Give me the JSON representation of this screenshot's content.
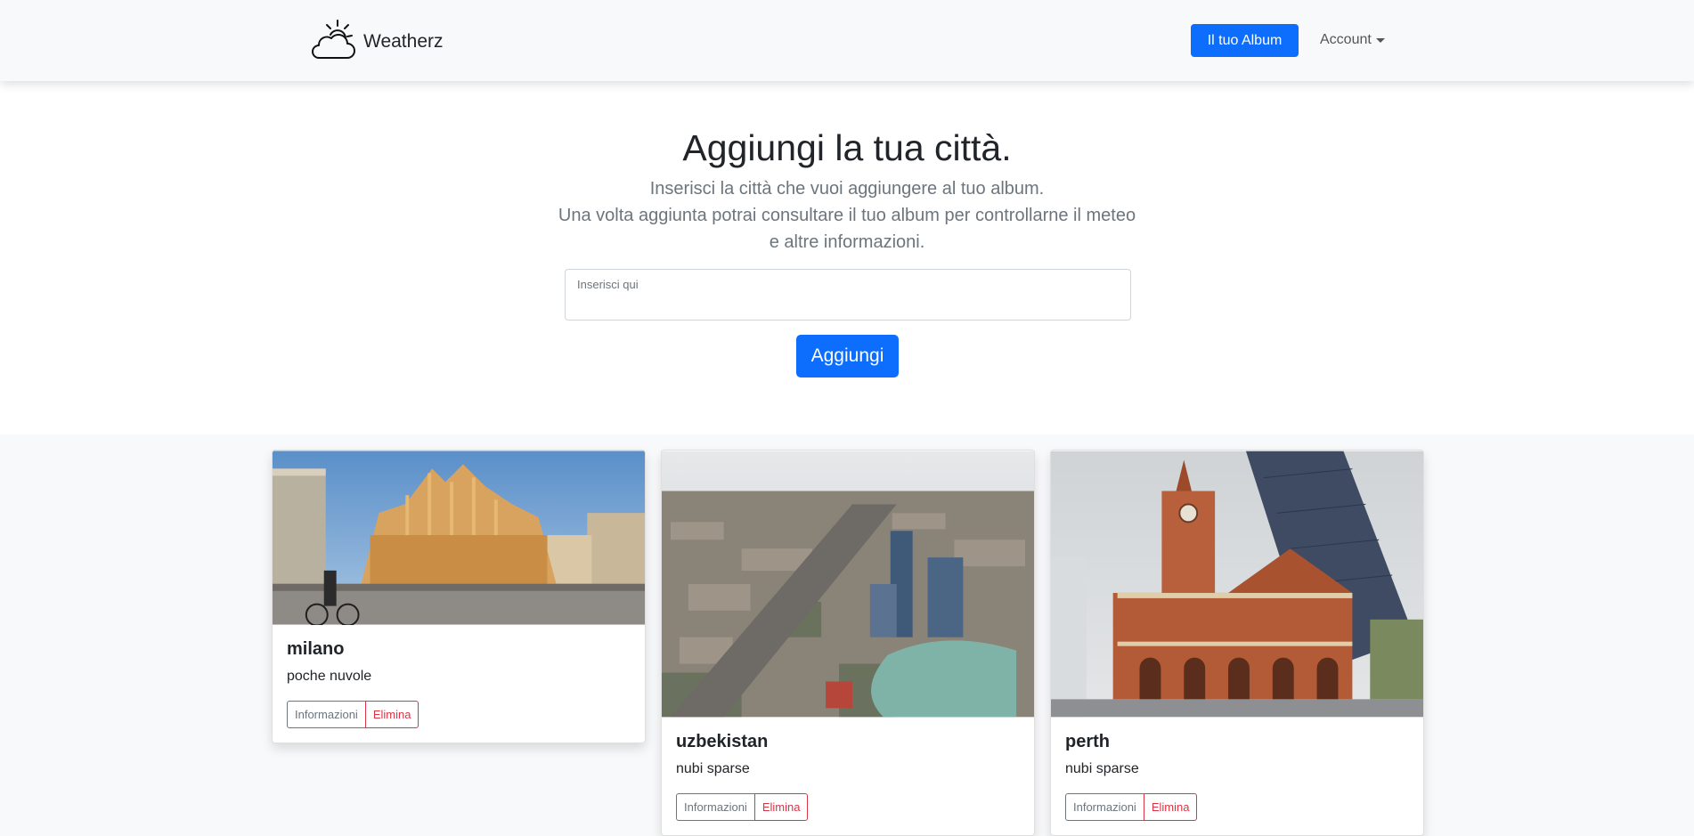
{
  "app": {
    "brand_name": "Weatherz",
    "brand_icon": "cloud-sun-icon",
    "accent_color": "#0d6efd",
    "danger_color": "#dc3545"
  },
  "nav": {
    "album_button": "Il tuo Album",
    "account_label": "Account"
  },
  "hero": {
    "title": "Aggiungi la tua città.",
    "lead_line1": "Inserisci la città che vuoi aggiungere al tuo album.",
    "lead_line2": "Una volta aggiunta potrai consultare il tuo album per controllarne il meteo e altre informazioni.",
    "input_label": "Inserisci qui",
    "input_value": "",
    "add_button": "Aggiungi"
  },
  "cards": [
    {
      "city": "milano",
      "weather": "poche nuvole",
      "info_button": "Informazioni",
      "delete_button": "Elimina"
    },
    {
      "city": "uzbekistan",
      "weather": "nubi sparse",
      "info_button": "Informazioni",
      "delete_button": "Elimina"
    },
    {
      "city": "perth",
      "weather": "nubi sparse",
      "info_button": "Informazioni",
      "delete_button": "Elimina"
    }
  ]
}
